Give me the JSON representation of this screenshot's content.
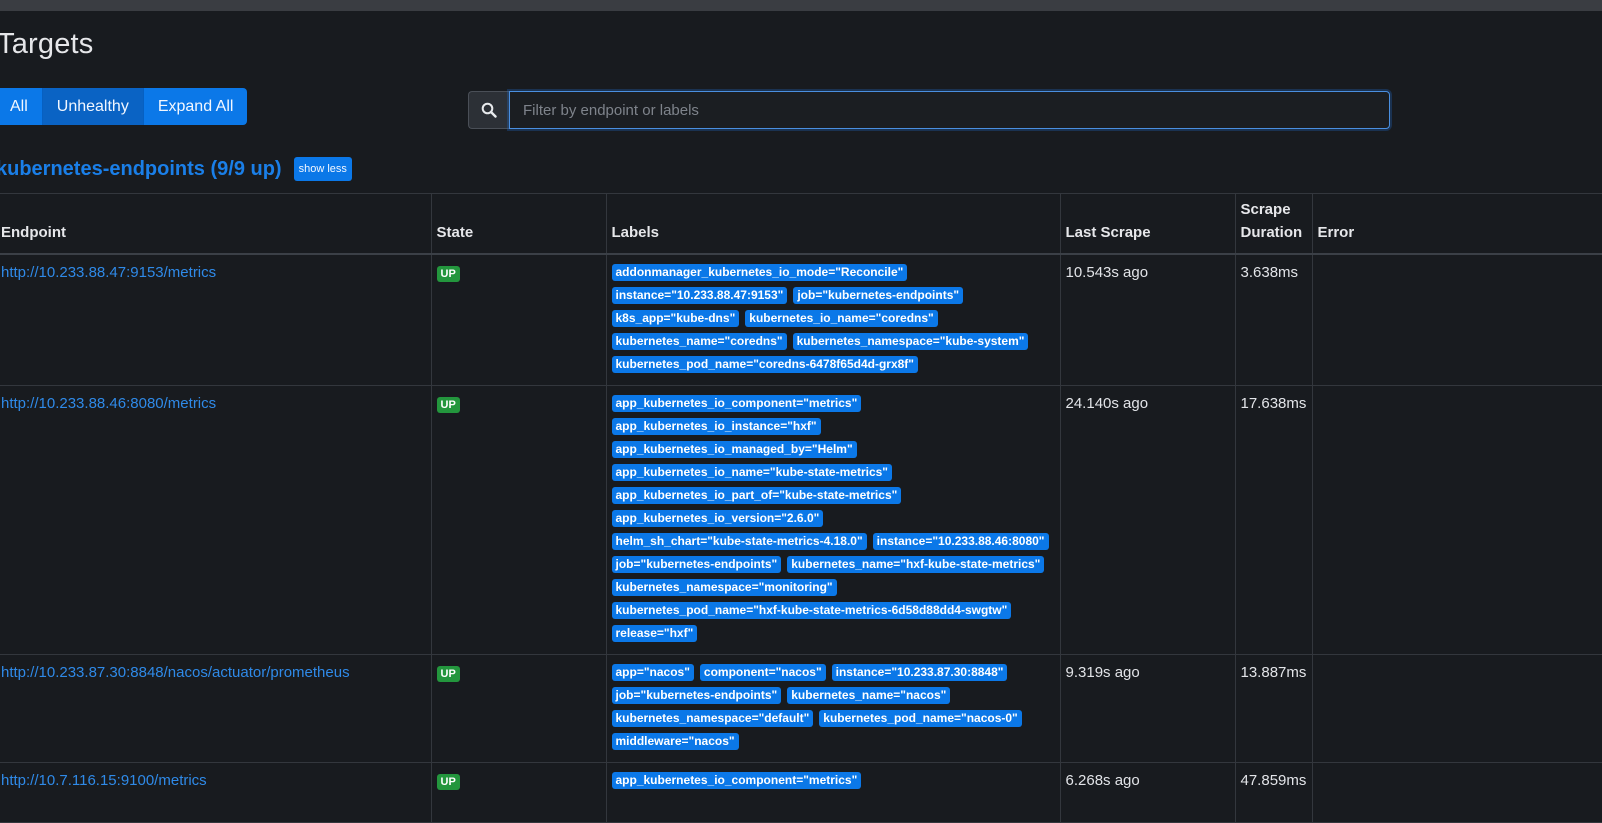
{
  "page": {
    "title": "Targets"
  },
  "filters": {
    "buttons": [
      "All",
      "Unhealthy",
      "Expand All"
    ],
    "active": "Unhealthy"
  },
  "search": {
    "placeholder": "Filter by endpoint or labels",
    "value": ""
  },
  "pool": {
    "title": "kubernetes-endpoints (9/9 up)",
    "toggle_label": "show less"
  },
  "table": {
    "headers": {
      "endpoint": "Endpoint",
      "state": "State",
      "labels": "Labels",
      "last_scrape": "Last Scrape",
      "scrape_duration_1": "Scrape",
      "scrape_duration_2": "Duration",
      "error": "Error"
    },
    "rows": [
      {
        "endpoint": "http://10.233.88.47:9153/metrics",
        "state": "UP",
        "labels": [
          "addonmanager_kubernetes_io_mode=\"Reconcile\"",
          "instance=\"10.233.88.47:9153\"",
          "job=\"kubernetes-endpoints\"",
          "k8s_app=\"kube-dns\"",
          "kubernetes_io_name=\"coredns\"",
          "kubernetes_name=\"coredns\"",
          "kubernetes_namespace=\"kube-system\"",
          "kubernetes_pod_name=\"coredns-6478f65d4d-grx8f\""
        ],
        "last_scrape": "10.543s ago",
        "scrape_duration": "3.638ms",
        "error": ""
      },
      {
        "endpoint": "http://10.233.88.46:8080/metrics",
        "state": "UP",
        "labels": [
          "app_kubernetes_io_component=\"metrics\"",
          "app_kubernetes_io_instance=\"hxf\"",
          "app_kubernetes_io_managed_by=\"Helm\"",
          "app_kubernetes_io_name=\"kube-state-metrics\"",
          "app_kubernetes_io_part_of=\"kube-state-metrics\"",
          "app_kubernetes_io_version=\"2.6.0\"",
          "helm_sh_chart=\"kube-state-metrics-4.18.0\"",
          "instance=\"10.233.88.46:8080\"",
          "job=\"kubernetes-endpoints\"",
          "kubernetes_name=\"hxf-kube-state-metrics\"",
          "kubernetes_namespace=\"monitoring\"",
          "kubernetes_pod_name=\"hxf-kube-state-metrics-6d58d88dd4-swgtw\"",
          "release=\"hxf\""
        ],
        "last_scrape": "24.140s ago",
        "scrape_duration": "17.638ms",
        "error": ""
      },
      {
        "endpoint": "http://10.233.87.30:8848/nacos/actuator/prometheus",
        "state": "UP",
        "labels": [
          "app=\"nacos\"",
          "component=\"nacos\"",
          "instance=\"10.233.87.30:8848\"",
          "job=\"kubernetes-endpoints\"",
          "kubernetes_name=\"nacos\"",
          "kubernetes_namespace=\"default\"",
          "kubernetes_pod_name=\"nacos-0\"",
          "middleware=\"nacos\""
        ],
        "last_scrape": "9.319s ago",
        "scrape_duration": "13.887ms",
        "error": ""
      },
      {
        "endpoint": "http://10.7.116.15:9100/metrics",
        "state": "UP",
        "labels": [
          "app_kubernetes_io_component=\"metrics\""
        ],
        "last_scrape": "6.268s ago",
        "scrape_duration": "47.859ms",
        "error": ""
      }
    ]
  }
}
